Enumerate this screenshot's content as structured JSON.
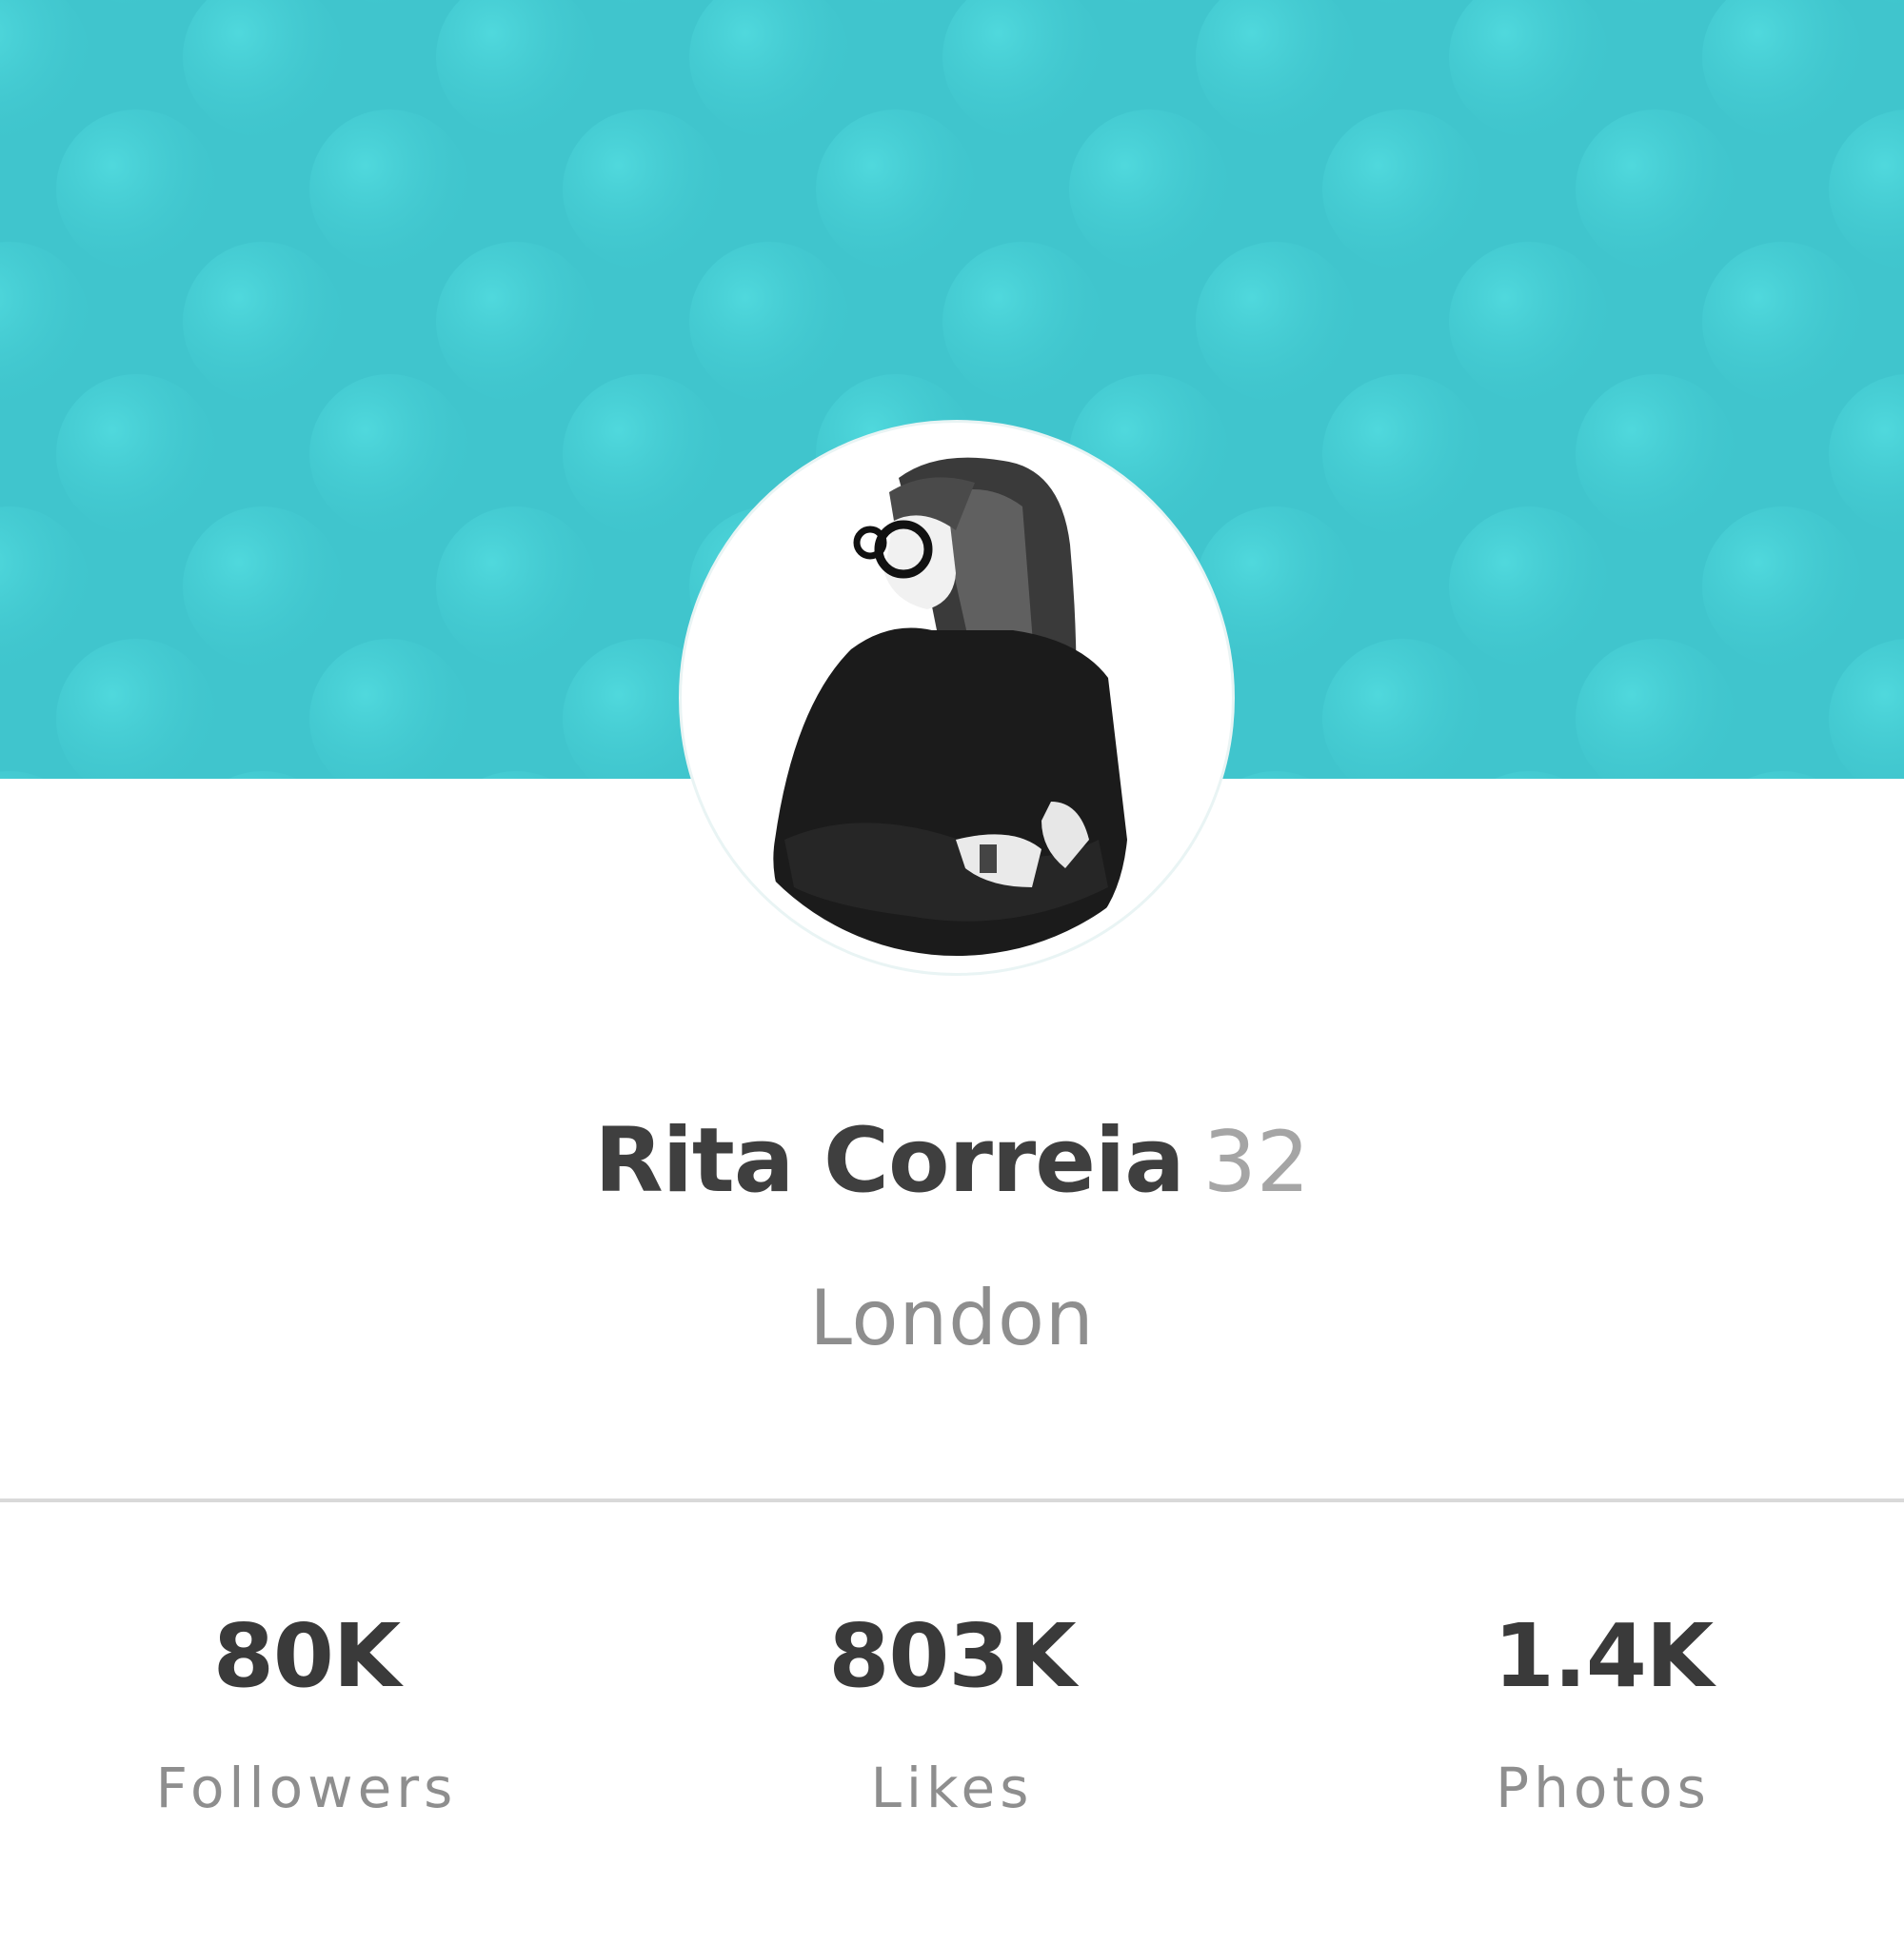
{
  "colors": {
    "header_teal": "#40c5cd",
    "name_text": "#3f3f3f",
    "muted_text": "#8e8e8e"
  },
  "profile": {
    "name": "Rita Correia",
    "age": "32",
    "location": "London",
    "avatar_icon": "profile-photo"
  },
  "stats": [
    {
      "value": "80K",
      "label": "Followers"
    },
    {
      "value": "803K",
      "label": "Likes"
    },
    {
      "value": "1.4K",
      "label": "Photos"
    }
  ]
}
